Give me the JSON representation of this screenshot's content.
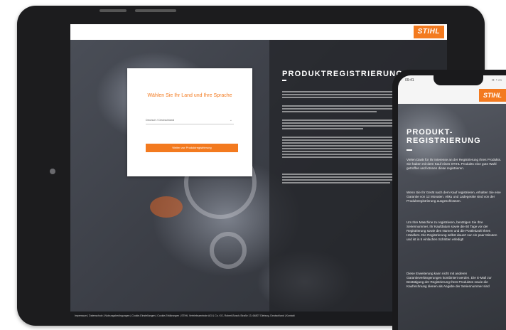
{
  "tablet": {
    "brand_logo": "STIHL",
    "modal": {
      "title": "Wählen Sie Ihr Land und Ihre Sprache",
      "select_value": "Deutsch / Deutschland",
      "button_label": "Weiter zur Produktregistrierung"
    },
    "heading": "PRODUKTREGISTRIERUNG",
    "footer_text": "Impressum | Datenschutz | Nutzungsbedingungen | Cookie-Einstellungen | Cookie-Erklärungen | STIHL Vertriebszentrale AG & Co. KG, Robert-Bosch-Straße 13, 64807 Dieburg, Deutschland | Kontakt"
  },
  "phone": {
    "time": "09:41",
    "status_icons": "▪▪ ◔ ▭",
    "brand_logo": "STIHL",
    "heading": "PRODUKT-\nREGISTRIERUNG",
    "paragraphs": [
      "Vielen Dank für Ihr Interesse an der Registrierung Ihres Produkts. Sie haben mit dem Kauf eines STIHL Produkts eine gute Wahl getroffen und können diese registrieren.",
      "Wenn Sie Ihr Gerät nach dem Kauf registrieren, erhalten Sie eine Garantie von 12 Monaten. Akku und Ladegeräte sind von der Produktregistrierung ausgeschlossen.",
      "Um Ihre Maschine zu registrieren, benötigen Sie Ihre Seriennummer, Ihr Kaufdatum sowie die 60 Tage vor der Registrierung sowie den Namen und die Postleitzahl Ihres Händlers. Die Registrierung selbst dauert nur ein paar Minuten und ist in 5 einfachen Schritten erledigt!",
      "Diese Erweiterung kann nicht mit anderen Garantieverlängerungen kombiniert werden. Die E-Mail zur Bestätigung der Registrierung Ihres Produktes sowie die Kaufrechnung dienen als Angabe der Seriennummer sind"
    ]
  },
  "colors": {
    "accent": "#f37a1f",
    "device_frame": "#1c1c1e"
  }
}
